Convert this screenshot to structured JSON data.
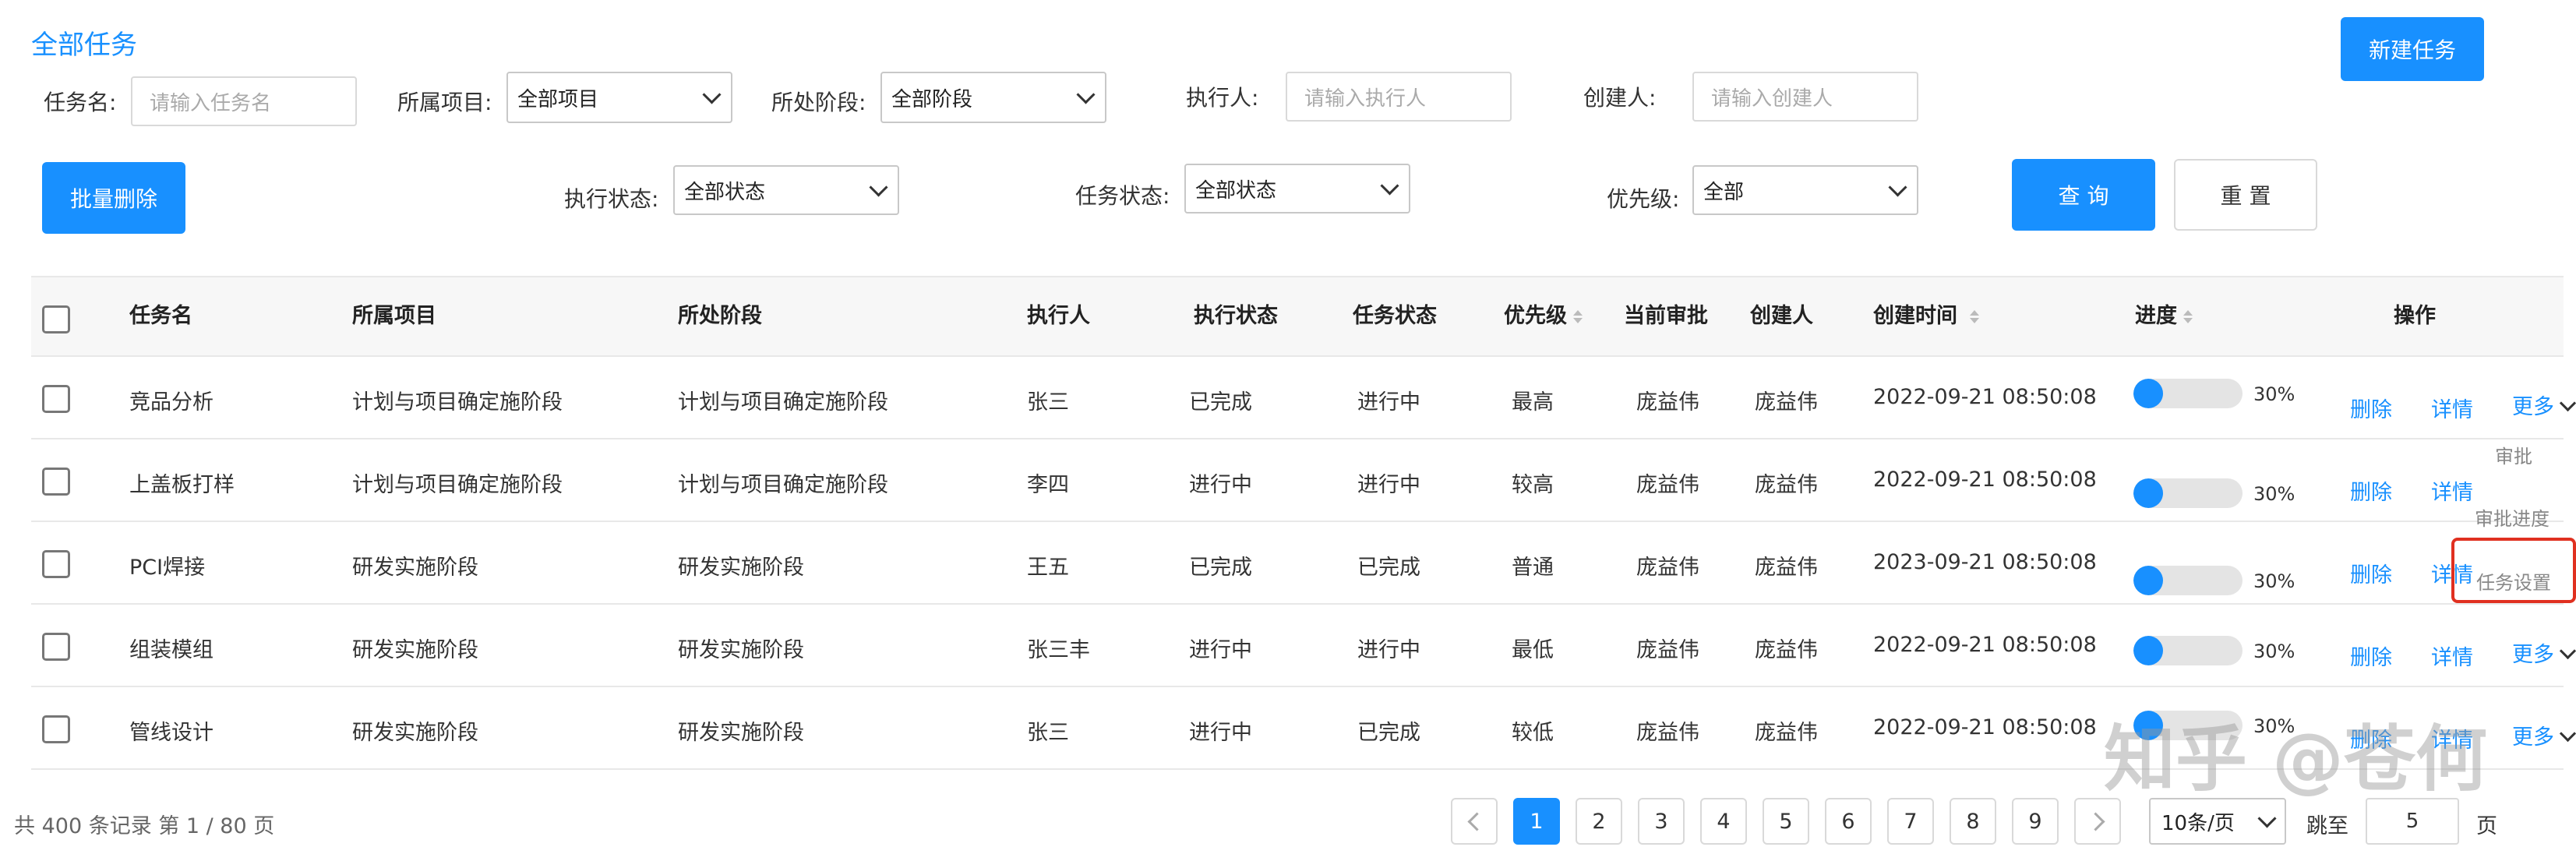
{
  "page": {
    "title": "全部任务",
    "new_task_label": "新建任务"
  },
  "filters": {
    "task_name": {
      "label": "任务名:",
      "placeholder": "请输入任务名"
    },
    "project": {
      "label": "所属项目:",
      "value": "全部项目"
    },
    "stage": {
      "label": "所处阶段:",
      "value": "全部阶段"
    },
    "executor": {
      "label": "执行人:",
      "placeholder": "请输入执行人"
    },
    "creator": {
      "label": "创建人:",
      "placeholder": "请输入创建人"
    },
    "exec_status": {
      "label": "执行状态:",
      "value": "全部状态"
    },
    "task_status": {
      "label": "任务状态:",
      "value": "全部状态"
    },
    "priority": {
      "label": "优先级:",
      "value": "全部"
    },
    "batch_delete_label": "批量删除",
    "query_label": "查 询",
    "reset_label": "重 置"
  },
  "table": {
    "columns": [
      "任务名",
      "所属项目",
      "所处阶段",
      "执行人",
      "执行状态",
      "任务状态",
      "优先级",
      "当前审批",
      "创建人",
      "创建时间",
      "进度",
      "操作"
    ],
    "rows": [
      {
        "name": "竞品分析",
        "project": "计划与项目确定施阶段",
        "stage": "计划与项目确定施阶段",
        "executor": "张三",
        "exec_status": "已完成",
        "task_status": "进行中",
        "priority": "最高",
        "approver": "庞益伟",
        "creator": "庞益伟",
        "created": "2022-09-21  08:50:08",
        "progress": "30%",
        "progress_value": 0.3
      },
      {
        "name": "上盖板打样",
        "project": "计划与项目确定施阶段",
        "stage": "计划与项目确定施阶段",
        "executor": "李四",
        "exec_status": "进行中",
        "task_status": "进行中",
        "priority": "较高",
        "approver": "庞益伟",
        "creator": "庞益伟",
        "created": "2022-09-21  08:50:08",
        "progress": "30%",
        "progress_value": 0.3
      },
      {
        "name": "PCI焊接",
        "project": "研发实施阶段",
        "stage": "研发实施阶段",
        "executor": "王五",
        "exec_status": "已完成",
        "task_status": "已完成",
        "priority": "普通",
        "approver": "庞益伟",
        "creator": "庞益伟",
        "created": "2023-09-21  08:50:08",
        "progress": "30%",
        "progress_value": 0.3
      },
      {
        "name": "组装模组",
        "project": "研发实施阶段",
        "stage": "研发实施阶段",
        "executor": "张三丰",
        "exec_status": "进行中",
        "task_status": "进行中",
        "priority": "最低",
        "approver": "庞益伟",
        "creator": "庞益伟",
        "created": "2022-09-21  08:50:08",
        "progress": "30%",
        "progress_value": 0.3
      },
      {
        "name": "管线设计",
        "project": "研发实施阶段",
        "stage": "研发实施阶段",
        "executor": "张三",
        "exec_status": "进行中",
        "task_status": "已完成",
        "priority": "较低",
        "approver": "庞益伟",
        "creator": "庞益伟",
        "created": "2022-09-21  08:50:08",
        "progress": "30%",
        "progress_value": 0.3
      }
    ],
    "actions": {
      "delete": "删除",
      "detail": "详情",
      "more": "更多"
    }
  },
  "more_menu": {
    "items": [
      "审批",
      "审批进度",
      "任务设置"
    ],
    "highlighted": "任务设置"
  },
  "pagination": {
    "summary": "共 400 条记录 第 1 / 80 页",
    "pages": [
      "1",
      "2",
      "3",
      "4",
      "5",
      "6",
      "7",
      "8",
      "9"
    ],
    "current": "1",
    "page_size": "10条/页",
    "jump_label": "跳至",
    "jump_value": "5",
    "page_unit": "页"
  },
  "watermark": "知乎 @苍何",
  "colors": {
    "accent": "#1890ff",
    "highlight_border": "#e03020"
  }
}
